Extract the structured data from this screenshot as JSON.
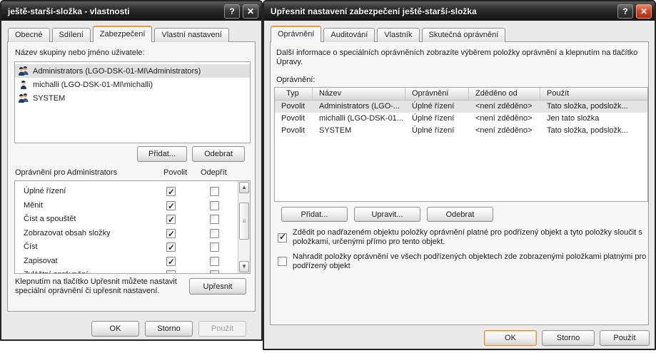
{
  "left_dialog": {
    "title": "ještě-starší-složka - vlastnosti",
    "titlebar": {
      "help_glyph": "?",
      "close_glyph": "✕"
    },
    "tabs": [
      {
        "label": "Obecné"
      },
      {
        "label": "Sdílení"
      },
      {
        "label": "Zabezpečení"
      },
      {
        "label": "Vlastní nastavení"
      }
    ],
    "group_list_label": "Název skupiny nebo jméno uživatele:",
    "users": [
      {
        "label": "Administrators (LGO-DSK-01-MI\\Administrators)",
        "icon": "group-icon",
        "selected": true
      },
      {
        "label": "michalli (LGO-DSK-01-MI\\michalli)",
        "icon": "user-icon",
        "selected": false
      },
      {
        "label": "SYSTEM",
        "icon": "group-icon",
        "selected": false
      }
    ],
    "add_button": "Přidat...",
    "remove_button": "Odebrat",
    "permissions_label": "Oprávnění pro Administrators",
    "allow_header": "Povolit",
    "deny_header": "Odepřít",
    "permissions": [
      {
        "name": "Úplné řízení",
        "allow": true,
        "deny": false
      },
      {
        "name": "Měnit",
        "allow": true,
        "deny": false
      },
      {
        "name": "Číst a spouštět",
        "allow": true,
        "deny": false
      },
      {
        "name": "Zobrazovat obsah složky",
        "allow": true,
        "deny": false
      },
      {
        "name": "Číst",
        "allow": true,
        "deny": false
      },
      {
        "name": "Zapisovat",
        "allow": true,
        "deny": false
      },
      {
        "name": "Zvláštní oprávnění",
        "allow": false,
        "deny": false
      }
    ],
    "advanced_hint": "Klepnutím na tlačítko Upřesnit můžete nastavit speciální oprávnění či upřesnit nastavení.",
    "advanced_button": "Upřesnit",
    "ok_button": "OK",
    "cancel_button": "Storno",
    "apply_button": "Použít"
  },
  "right_dialog": {
    "title": "Upřesnit nastavení zabezpečení ještě-starší-složka",
    "titlebar": {
      "help_glyph": "?",
      "close_glyph": "✕"
    },
    "tabs": [
      {
        "label": "Oprávnění"
      },
      {
        "label": "Auditování"
      },
      {
        "label": "Vlastník"
      },
      {
        "label": "Skutečná oprávnění"
      }
    ],
    "description": "Další informace o speciálních oprávněních zobrazíte výběrem položky oprávnění a klepnutím na tlačítko Úpravy.",
    "permissions_label": "Oprávnění:",
    "table": {
      "columns": [
        "Typ",
        "Název",
        "Oprávnění",
        "Zděděno od",
        "Použít"
      ],
      "rows": [
        {
          "selected": true,
          "cells": [
            "Povolit",
            "Administrators (LGO-...",
            "Úplné řízení",
            "<není zděděno>",
            "Tato složka, podsložk..."
          ]
        },
        {
          "selected": false,
          "cells": [
            "Povolit",
            "michalli (LGO-DSK-01...",
            "Úplné řízení",
            "<není zděděno>",
            "Jen tato složka"
          ]
        },
        {
          "selected": false,
          "cells": [
            "Povolit",
            "SYSTEM",
            "Úplné řízení",
            "<není zděděno>",
            "Tato složka, podsložk..."
          ]
        }
      ]
    },
    "add_button": "Přidat...",
    "edit_button": "Upravit...",
    "remove_button": "Odebrat",
    "inherit_checkbox": {
      "checked": true,
      "label": "Zdědit po nadřazeném objektu položky oprávnění platné pro podřízený objekt a tyto položky sloučit s položkami, určenými přímo pro tento objekt."
    },
    "replace_checkbox": {
      "checked": false,
      "label": "Nahradit položky oprávnění ve všech podřízených objektech zde zobrazenými položkami platnými pro podřízený objekt"
    },
    "ok_button": "OK",
    "cancel_button": "Storno",
    "apply_button": "Použít"
  }
}
